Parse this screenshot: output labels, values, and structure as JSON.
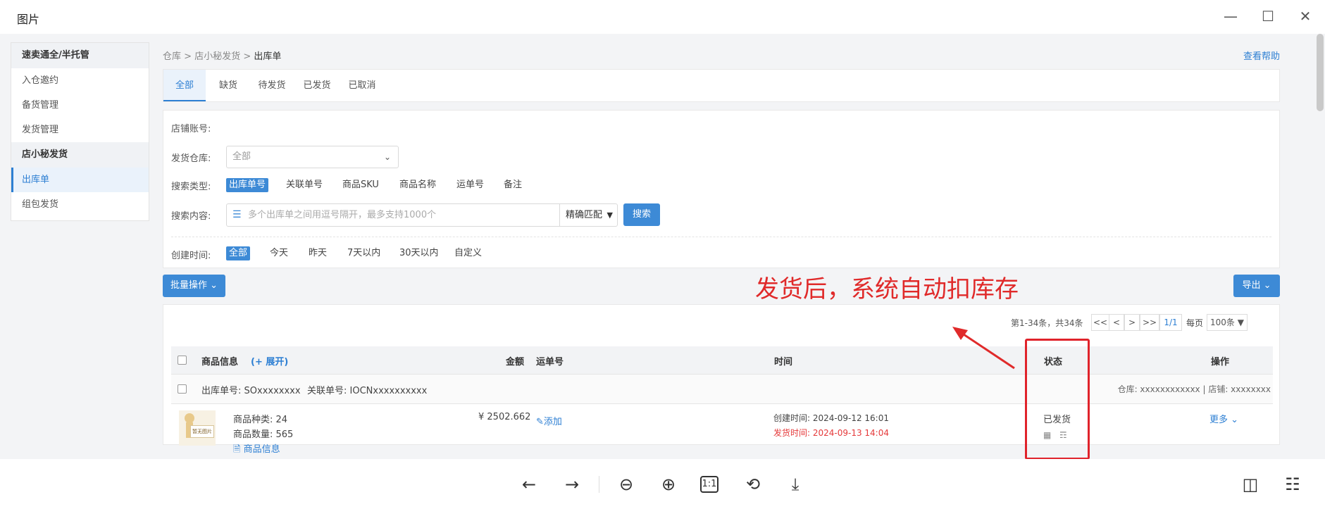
{
  "window": {
    "title": "图片"
  },
  "sidebar": {
    "groups": [
      {
        "title": "速卖通全/半托管",
        "items": [
          "入仓邀约",
          "备货管理",
          "发货管理"
        ]
      },
      {
        "title": "店小秘发货",
        "items": [
          "出库单",
          "组包发货"
        ]
      }
    ]
  },
  "breadcrumb": {
    "a": "仓库",
    "b": "店小秘发货",
    "c": "出库单",
    "sep": ">"
  },
  "help": "查看帮助",
  "tabs": [
    "全部",
    "缺货",
    "待发货",
    "已发货",
    "已取消"
  ],
  "filter": {
    "shop_label": "店铺账号:",
    "warehouse_label": "发货仓库:",
    "warehouse_value": "全部",
    "search_type_label": "搜索类型:",
    "search_types": [
      "出库单号",
      "关联单号",
      "商品SKU",
      "商品名称",
      "运单号",
      "备注"
    ],
    "search_content_label": "搜索内容:",
    "search_placeholder": "多个出库单之间用逗号隔开，最多支持1000个",
    "match": "精确匹配",
    "search_btn": "搜索",
    "time_label": "创建时间:",
    "times": [
      "全部",
      "今天",
      "昨天",
      "7天以内",
      "30天以内",
      "自定义"
    ]
  },
  "batch": "批量操作",
  "export": "导出",
  "annotation": "发货后，系统自动扣库存",
  "pagination": {
    "summary": "第1-34条，共34条",
    "first": "<<",
    "prev": "<",
    "next": ">",
    "last": ">>",
    "page": "1/1",
    "per_page_label": "每页",
    "per_page": "100条"
  },
  "table": {
    "headers": {
      "product": "商品信息",
      "expand": "(+ 展开)",
      "amount": "金额",
      "tracking": "运单号",
      "time": "时间",
      "status": "状态",
      "ops": "操作"
    },
    "order": {
      "out_no": "出库单号: SOxxxxxxxx",
      "rel_no": "关联单号: IOCNxxxxxxxxxx",
      "wh": "仓库: xxxxxxxxxxxx | 店铺: xxxxxxxx"
    },
    "row": {
      "kinds": "商品种类:  24",
      "qty": "商品数量:  565",
      "info": "商品信息",
      "no_image": "暂无图片",
      "amount": "¥ 2502.662",
      "add": "添加",
      "created": "创建时间:  2024-09-12 16:01",
      "shipped": "发货时间:  2024-09-13 14:04",
      "status": "已发货",
      "more": "更多"
    }
  }
}
